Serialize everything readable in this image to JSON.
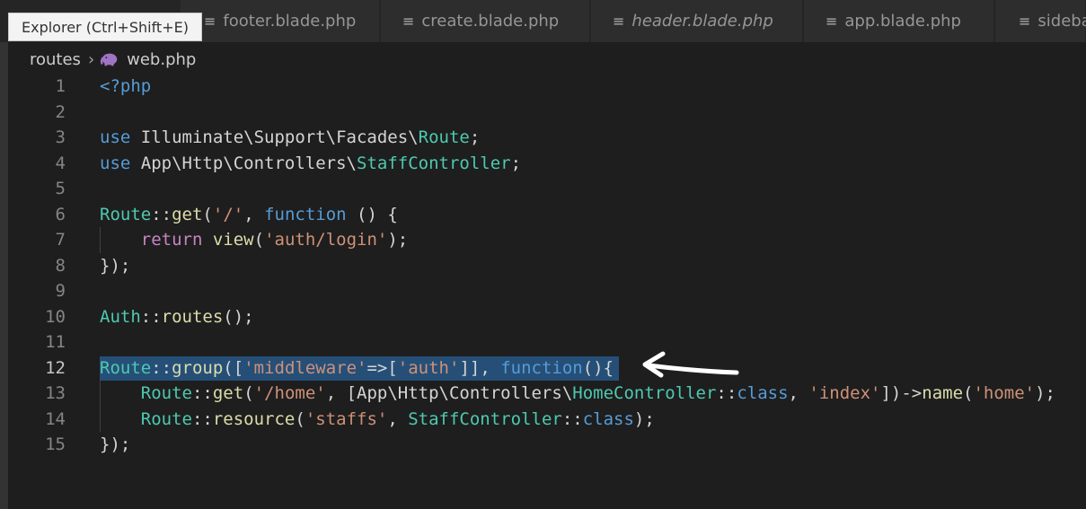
{
  "tabs": [
    {
      "label": "footer.blade.php",
      "italic": false
    },
    {
      "label": "create.blade.php",
      "italic": false
    },
    {
      "label": "header.blade.php",
      "italic": true
    },
    {
      "label": "app.blade.php",
      "italic": false
    },
    {
      "label": "sideba",
      "italic": false
    }
  ],
  "tooltip": "Explorer (Ctrl+Shift+E)",
  "breadcrumb": {
    "folder": "routes",
    "file": "web.php"
  },
  "active_line": 12,
  "lines": [
    {
      "n": "1",
      "tokens": [
        [
          "kw",
          "<?php"
        ]
      ]
    },
    {
      "n": "2",
      "tokens": []
    },
    {
      "n": "3",
      "tokens": [
        [
          "kw",
          "use"
        ],
        [
          "txt",
          " Illuminate\\Support\\Facades\\"
        ],
        [
          "cls",
          "Route"
        ],
        [
          "txt",
          ";"
        ]
      ]
    },
    {
      "n": "4",
      "tokens": [
        [
          "kw",
          "use"
        ],
        [
          "txt",
          " App\\Http\\Controllers\\"
        ],
        [
          "cls",
          "StaffController"
        ],
        [
          "txt",
          ";"
        ]
      ]
    },
    {
      "n": "5",
      "tokens": []
    },
    {
      "n": "6",
      "tokens": [
        [
          "cls",
          "Route"
        ],
        [
          "op",
          "::"
        ],
        [
          "fn",
          "get"
        ],
        [
          "txt",
          "("
        ],
        [
          "str",
          "'/'"
        ],
        [
          "txt",
          ", "
        ],
        [
          "kw",
          "function"
        ],
        [
          "txt",
          " () {"
        ]
      ]
    },
    {
      "n": "7",
      "tokens": [
        [
          "txt",
          "    "
        ],
        [
          "ctl",
          "return"
        ],
        [
          "txt",
          " "
        ],
        [
          "fn",
          "view"
        ],
        [
          "txt",
          "("
        ],
        [
          "str",
          "'auth/login'"
        ],
        [
          "txt",
          ");"
        ]
      ],
      "guide": true
    },
    {
      "n": "8",
      "tokens": [
        [
          "txt",
          "});"
        ]
      ]
    },
    {
      "n": "9",
      "tokens": []
    },
    {
      "n": "10",
      "tokens": [
        [
          "cls",
          "Auth"
        ],
        [
          "op",
          "::"
        ],
        [
          "fn",
          "routes"
        ],
        [
          "txt",
          "();"
        ]
      ]
    },
    {
      "n": "11",
      "tokens": []
    },
    {
      "n": "12",
      "tokens": [
        [
          "cls",
          "Route"
        ],
        [
          "op",
          "::"
        ],
        [
          "fn",
          "group"
        ],
        [
          "txt",
          "(["
        ],
        [
          "str",
          "'middleware'"
        ],
        [
          "txt",
          "=>["
        ],
        [
          "str",
          "'auth'"
        ],
        [
          "txt",
          "]], "
        ],
        [
          "kw",
          "function"
        ],
        [
          "txt",
          "(){"
        ]
      ],
      "selected": true
    },
    {
      "n": "13",
      "tokens": [
        [
          "txt",
          "    "
        ],
        [
          "cls",
          "Route"
        ],
        [
          "op",
          "::"
        ],
        [
          "fn",
          "get"
        ],
        [
          "txt",
          "("
        ],
        [
          "str",
          "'/home'"
        ],
        [
          "txt",
          ", [App\\Http\\Controllers\\"
        ],
        [
          "cls",
          "HomeController"
        ],
        [
          "op",
          "::"
        ],
        [
          "kw",
          "class"
        ],
        [
          "txt",
          ", "
        ],
        [
          "str",
          "'index'"
        ],
        [
          "txt",
          "])->"
        ],
        [
          "fn",
          "name"
        ],
        [
          "txt",
          "("
        ],
        [
          "str",
          "'home'"
        ],
        [
          "txt",
          ");"
        ]
      ],
      "guide": true
    },
    {
      "n": "14",
      "tokens": [
        [
          "txt",
          "    "
        ],
        [
          "cls",
          "Route"
        ],
        [
          "op",
          "::"
        ],
        [
          "fn",
          "resource"
        ],
        [
          "txt",
          "("
        ],
        [
          "str",
          "'staffs'"
        ],
        [
          "txt",
          ", "
        ],
        [
          "cls",
          "StaffController"
        ],
        [
          "op",
          "::"
        ],
        [
          "kw",
          "class"
        ],
        [
          "txt",
          ");"
        ]
      ],
      "guide": true
    },
    {
      "n": "15",
      "tokens": [
        [
          "txt",
          "});"
        ]
      ]
    }
  ],
  "colors": {
    "background": "#1e1e1e",
    "selection": "#264f78",
    "keyword": "#569cd6",
    "class": "#4ec9b0",
    "function": "#dcdcaa",
    "string": "#ce9178",
    "control": "#c586c0"
  },
  "icons": {
    "tab": "lines-file-icon",
    "breadcrumb_separator": "chevron-right-icon",
    "file": "php-elephant-icon",
    "annotation": "hand-drawn-arrow-icon"
  }
}
